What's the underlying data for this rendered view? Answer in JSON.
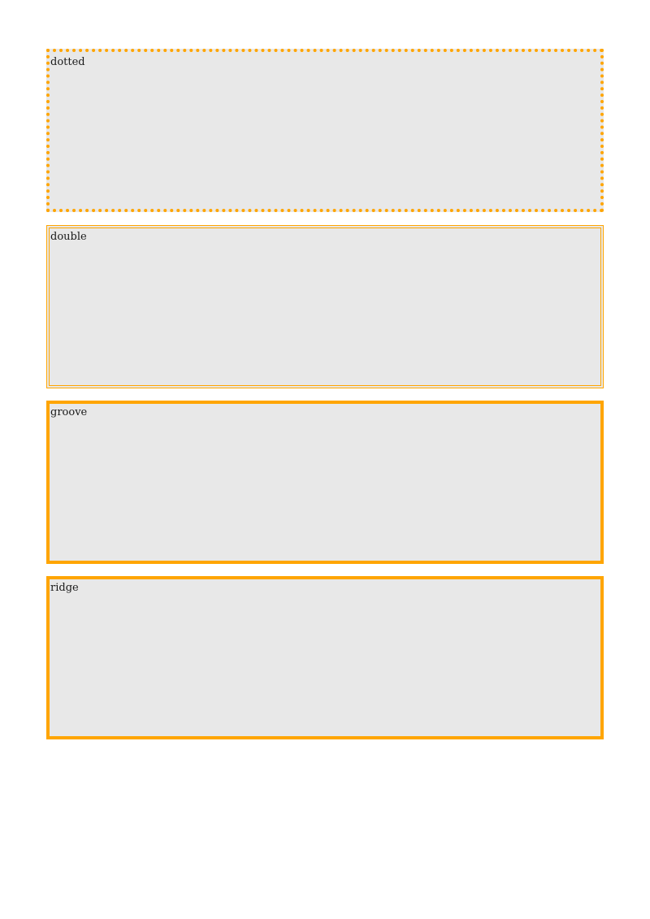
{
  "accent_color": "#ffa500",
  "box_background": "#e8e8e8",
  "boxes": [
    {
      "style": "dotted",
      "label": "dotted"
    },
    {
      "style": "double",
      "label": "double"
    },
    {
      "style": "groove",
      "label": "groove"
    },
    {
      "style": "ridge",
      "label": "ridge"
    }
  ]
}
